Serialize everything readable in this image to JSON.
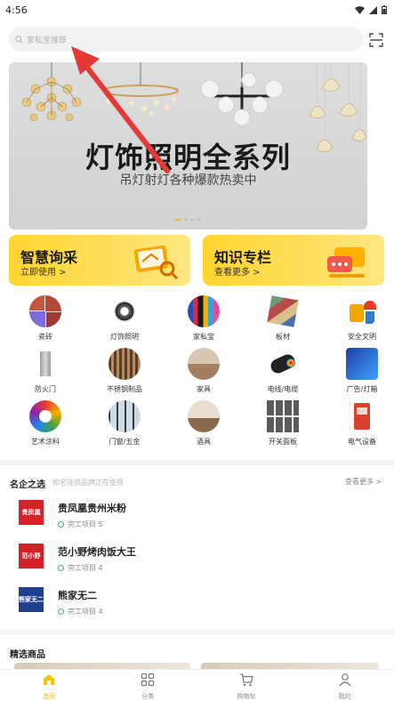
{
  "status_bar": {
    "time": "4:56"
  },
  "search": {
    "placeholder": "家私宝推荐"
  },
  "banner": {
    "title": "灯饰照明全系列",
    "subtitle": "吊灯射灯各种爆款热卖中"
  },
  "promos": [
    {
      "title": "智慧询采",
      "subtitle": "立即使用 >"
    },
    {
      "title": "知识专栏",
      "subtitle": "查看更多 >"
    }
  ],
  "categories": [
    {
      "label": "瓷砖",
      "icon": "tile-icon"
    },
    {
      "label": "灯饰照明",
      "icon": "lamp-icon"
    },
    {
      "label": "家私宝",
      "icon": "furniture-icon"
    },
    {
      "label": "板材",
      "icon": "board-icon"
    },
    {
      "label": "安全文明",
      "icon": "safety-icon"
    },
    {
      "label": "防火门",
      "icon": "fire-door-icon"
    },
    {
      "label": "不锈钢制品",
      "icon": "stainless-icon"
    },
    {
      "label": "家具",
      "icon": "sofa-icon"
    },
    {
      "label": "电线/电缆",
      "icon": "cable-icon"
    },
    {
      "label": "广告/灯箱",
      "icon": "lightbox-icon"
    },
    {
      "label": "艺术涂料",
      "icon": "paint-icon"
    },
    {
      "label": "门窗/五金",
      "icon": "window-icon"
    },
    {
      "label": "酒具",
      "icon": "wine-icon"
    },
    {
      "label": "开关面板",
      "icon": "switch-icon"
    },
    {
      "label": "电气设备",
      "icon": "electric-icon"
    }
  ],
  "brands_section": {
    "title": "名企之选",
    "note": "知名连锁品牌正在使用",
    "more": "查看更多 >",
    "items": [
      {
        "name": "贵凤凰贵州米粉",
        "logo_text": "贵凤凰",
        "logo_color": "#d6232a",
        "meta": "完工项目 5"
      },
      {
        "name": "范小野烤肉饭大王",
        "logo_text": "范小野",
        "logo_color": "#d41f26",
        "meta": "完工项目 4"
      },
      {
        "name": "熊家无二",
        "logo_text": "熊家无二",
        "logo_color": "#1f3f8f",
        "meta": "完工项目 4"
      }
    ]
  },
  "featured": {
    "title": "精选商品"
  },
  "bottom_nav": [
    {
      "label": "首页",
      "icon": "home-icon",
      "active": true
    },
    {
      "label": "分类",
      "icon": "category-grid-icon",
      "active": false
    },
    {
      "label": "购物车",
      "icon": "cart-icon",
      "active": false
    },
    {
      "label": "我的",
      "icon": "profile-icon",
      "active": false
    }
  ],
  "colors": {
    "accent": "#f2b100",
    "promo_yellow": "#ffd52e",
    "annotation_red": "#e53935"
  }
}
